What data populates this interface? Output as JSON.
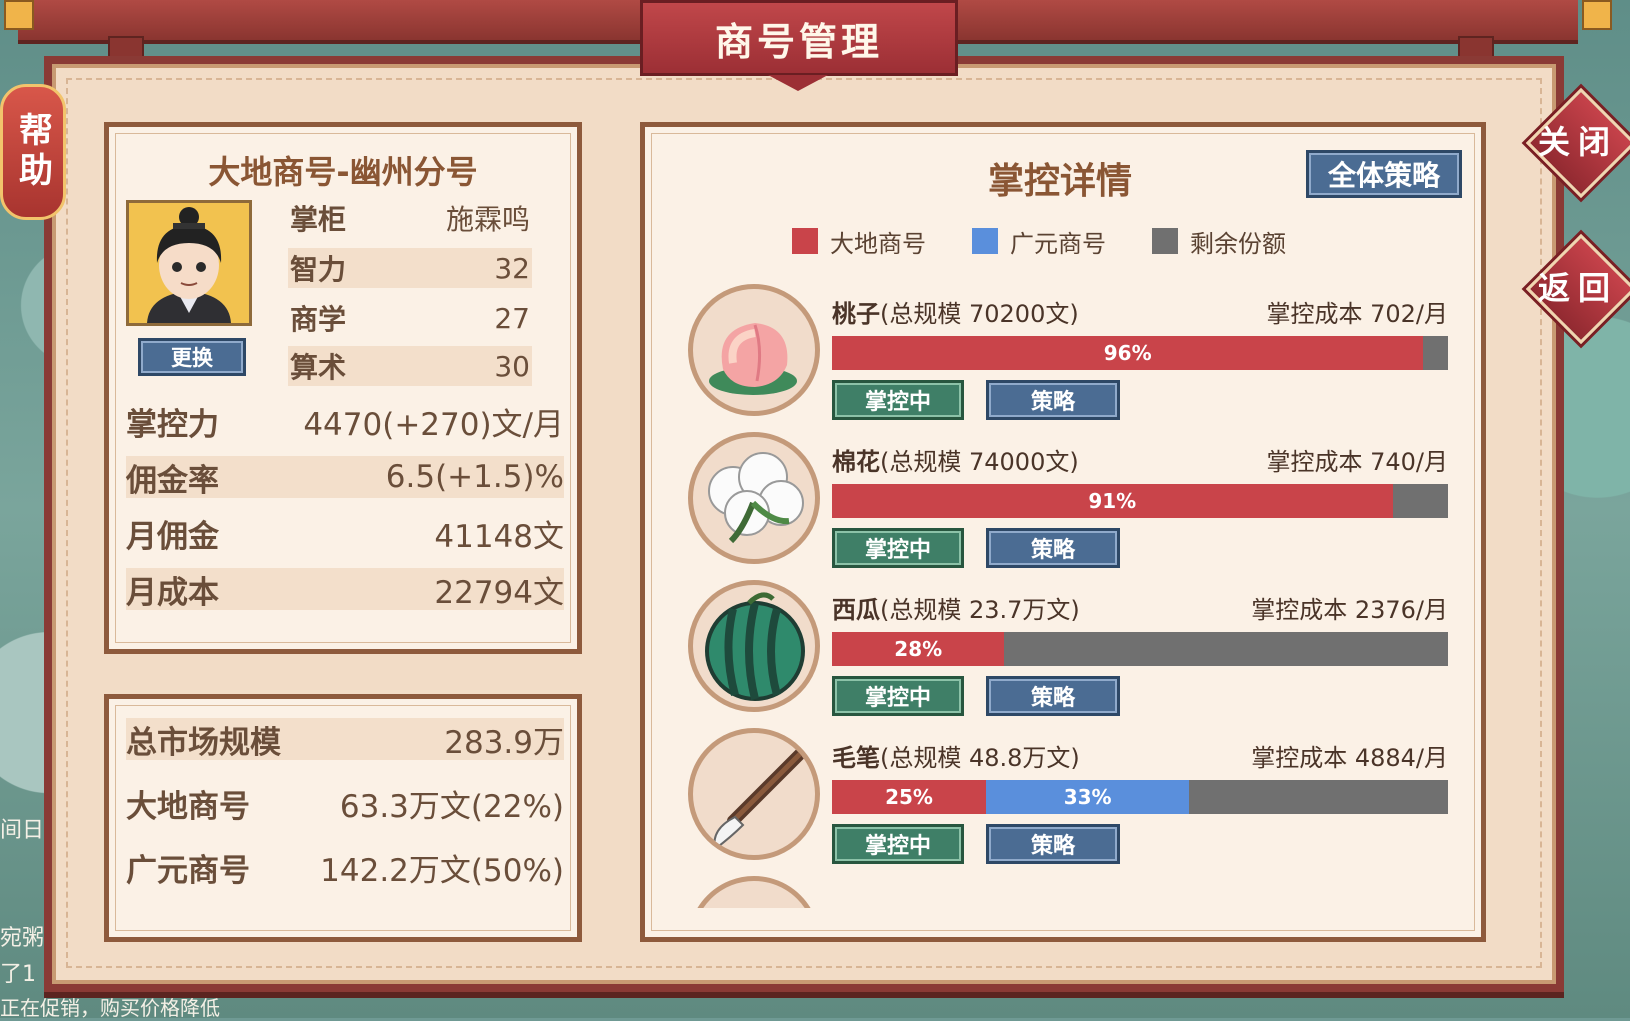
{
  "window_title": "商号管理",
  "help_label": "帮助",
  "close_label": "关闭",
  "back_label": "返回",
  "shop": {
    "name": "大地商号-幽州分号",
    "swap_label": "更换",
    "manager_key": "掌柜",
    "manager_name": "施霖鸣",
    "stats": [
      {
        "key": "智力",
        "value": "32"
      },
      {
        "key": "商学",
        "value": "27"
      },
      {
        "key": "算术",
        "value": "30"
      }
    ],
    "rows": [
      {
        "key": "掌控力",
        "value": "4470(+270)文/月"
      },
      {
        "key": "佣金率",
        "value": "6.5(+1.5)%"
      },
      {
        "key": "月佣金",
        "value": "41148文"
      },
      {
        "key": "月成本",
        "value": "22794文"
      }
    ]
  },
  "market": {
    "rows": [
      {
        "key": "总市场规模",
        "value": "283.9万"
      },
      {
        "key": "大地商号",
        "value": "63.3万文(22%)"
      },
      {
        "key": "广元商号",
        "value": "142.2万文(50%)"
      }
    ]
  },
  "control": {
    "title": "掌控详情",
    "all_strategy_label": "全体策略",
    "legend": [
      {
        "name": "大地商号",
        "color": "#c9444a"
      },
      {
        "name": "广元商号",
        "color": "#5a8fdc"
      },
      {
        "name": "剩余份额",
        "color": "#707070"
      }
    ],
    "controlling_label": "掌控中",
    "strategy_label": "策略",
    "items": [
      {
        "name": "桃子",
        "scale": "(总规模 70200文)",
        "cost": "掌控成本 702/月",
        "dadi": 96,
        "dadi_label": "96%",
        "guangyuan": 0,
        "guangyuan_label": "",
        "icon": "peach-icon"
      },
      {
        "name": "棉花",
        "scale": "(总规模 74000文)",
        "cost": "掌控成本 740/月",
        "dadi": 91,
        "dadi_label": "91%",
        "guangyuan": 0,
        "guangyuan_label": "",
        "icon": "cotton-icon"
      },
      {
        "name": "西瓜",
        "scale": "(总规模 23.7万文)",
        "cost": "掌控成本 2376/月",
        "dadi": 28,
        "dadi_label": "28%",
        "guangyuan": 0,
        "guangyuan_label": "",
        "icon": "watermelon-icon"
      },
      {
        "name": "毛笔",
        "scale": "(总规模 48.8万文)",
        "cost": "掌控成本 4884/月",
        "dadi": 25,
        "dadi_label": "25%",
        "guangyuan": 33,
        "guangyuan_label": "33%",
        "icon": "brush-icon"
      }
    ]
  },
  "background_text": [
    "间日",
    "宛粥",
    "了1",
    "正在促销，购买价格降低"
  ]
}
